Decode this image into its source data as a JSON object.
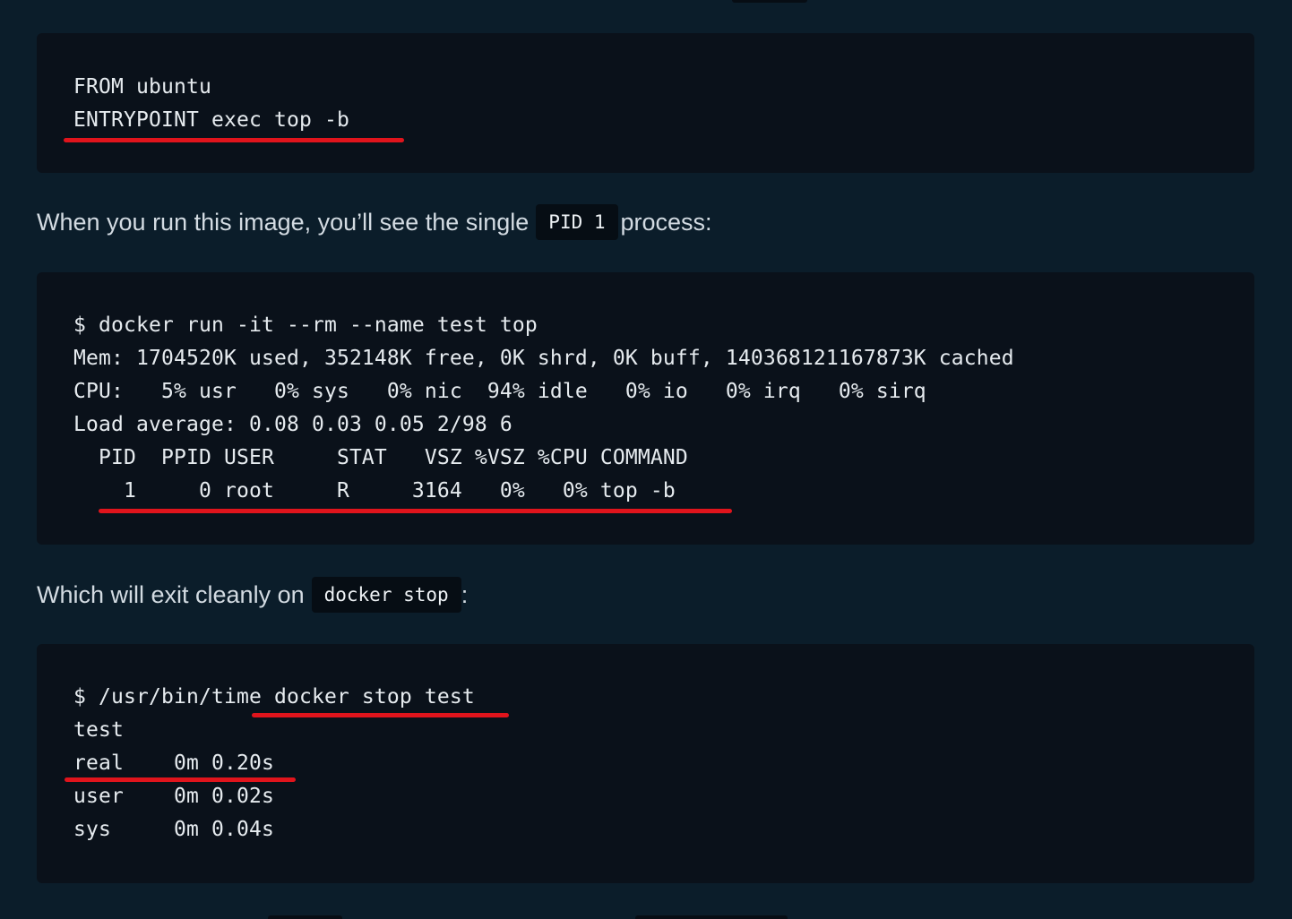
{
  "block1": {
    "lines": [
      "FROM ubuntu",
      "ENTRYPOINT exec top -b"
    ]
  },
  "para1": {
    "before": "When you run this image, you’ll see the single",
    "code": "PID 1",
    "after": "process:"
  },
  "block2": {
    "lines": [
      "$ docker run -it --rm --name test top",
      "Mem: 1704520K used, 352148K free, 0K shrd, 0K buff, 140368121167873K cached",
      "CPU:   5% usr   0% sys   0% nic  94% idle   0% io   0% irq   0% sirq",
      "Load average: 0.08 0.03 0.05 2/98 6",
      "  PID  PPID USER     STAT   VSZ %VSZ %CPU COMMAND",
      "    1     0 root     R     3164   0%   0% top -b"
    ]
  },
  "para2": {
    "before": "Which will exit cleanly on",
    "code": "docker stop",
    "after": ":"
  },
  "block3": {
    "lines": [
      "$ /usr/bin/time docker stop test",
      "test",
      "real    0m 0.20s",
      "user    0m 0.02s",
      "sys     0m 0.04s"
    ]
  },
  "colors": {
    "page_background": "#0b1d2a",
    "code_background": "#0a111a",
    "inline_code_background": "#060d14",
    "annotation_red": "#e0141c"
  }
}
